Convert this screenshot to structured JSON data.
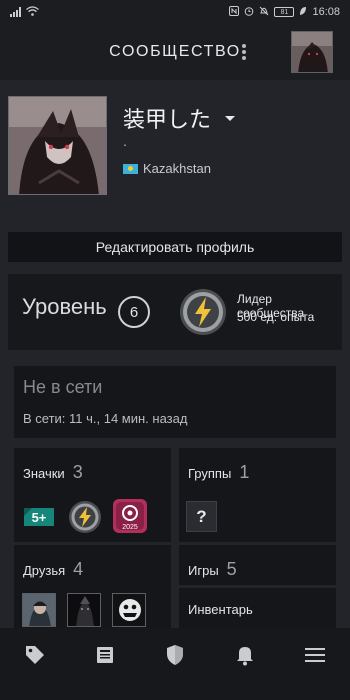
{
  "status_bar": {
    "time": "16:08",
    "battery": "81",
    "icons": [
      "signal-icon",
      "wifi-icon",
      "nfc-icon",
      "alarm-icon",
      "mute-icon",
      "battery-icon",
      "leaf-icon"
    ]
  },
  "header": {
    "title": "СООБЩЕСТВО",
    "menu_icon": "kebab-menu-icon",
    "avatar_icon": "user-avatar"
  },
  "profile": {
    "name": "装甲した",
    "summary": ".",
    "country": "Kazakhstan",
    "flag_icon": "kazakhstan-flag-icon"
  },
  "edit_button": {
    "label": "Редактировать профиль"
  },
  "level": {
    "label": "Уровень",
    "value": "6",
    "badge_title": "Лидер сообщества",
    "badge_xp": "500 ед. опыта",
    "badge_icon": "community-leader-badge-icon"
  },
  "online_status": {
    "state": "Не в сети",
    "last_online": "В сети: 11 ч., 14 мин. назад"
  },
  "badges": {
    "label": "Значки",
    "count": "3",
    "items": [
      {
        "icon": "years-of-service-badge-icon",
        "text": "5+"
      },
      {
        "icon": "community-leader-badge-icon",
        "text": ""
      },
      {
        "icon": "steam-replay-badge-icon",
        "text": "2025"
      }
    ]
  },
  "groups": {
    "label": "Группы",
    "count": "1",
    "placeholder": "?"
  },
  "friends": {
    "label": "Друзья",
    "count": "4"
  },
  "games": {
    "label": "Игры",
    "count": "5"
  },
  "inventory": {
    "label": "Инвентарь"
  },
  "nav": {
    "items": [
      "store-tag-icon",
      "news-icon",
      "shield-icon",
      "bell-icon",
      "hamburger-menu-icon"
    ]
  },
  "colors": {
    "background": "#1c1d21",
    "panel": "#15161a",
    "text": "#dfe3e6",
    "muted": "#858a8f",
    "badge_green": "#1b7a6f",
    "badge_pink": "#b0305a"
  }
}
